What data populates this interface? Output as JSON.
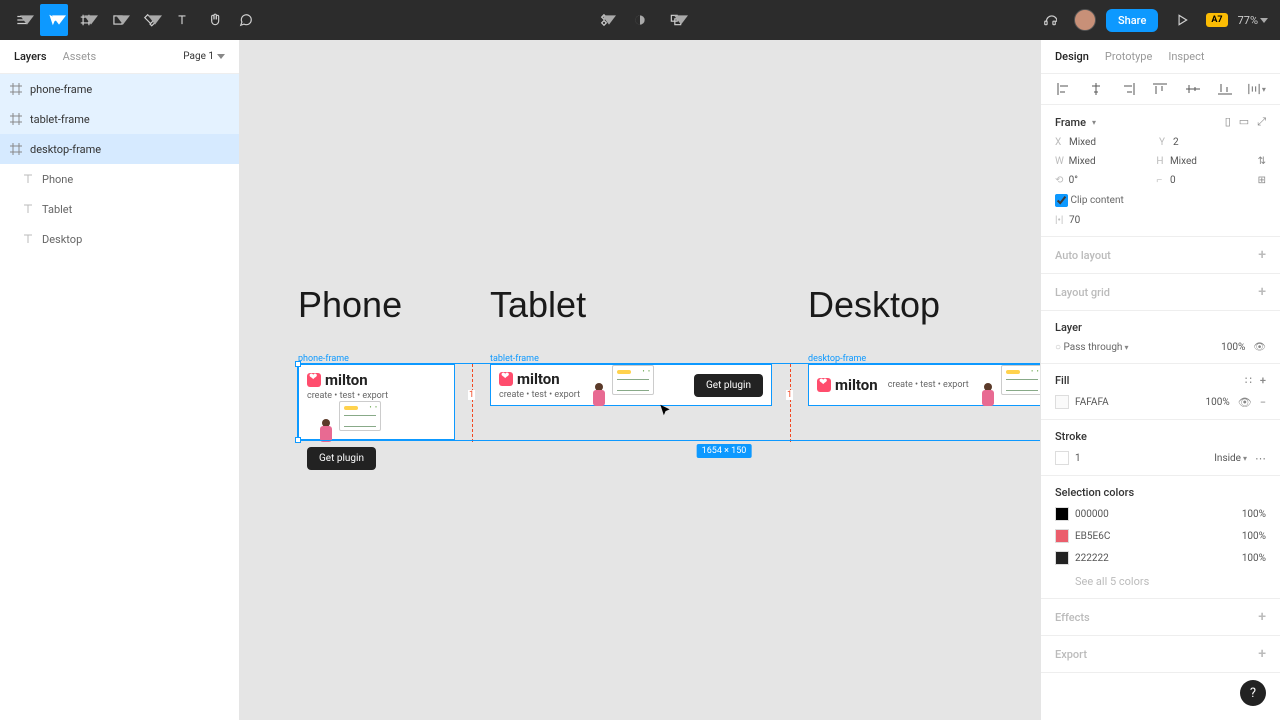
{
  "toolbar": {
    "share_label": "Share",
    "badge": "A7",
    "zoom": "77%"
  },
  "left_panel": {
    "tabs": {
      "layers": "Layers",
      "assets": "Assets"
    },
    "page_label": "Page 1",
    "layers": [
      {
        "name": "phone-frame",
        "icon": "frame",
        "selected": true
      },
      {
        "name": "tablet-frame",
        "icon": "frame",
        "selected": true
      },
      {
        "name": "desktop-frame",
        "icon": "frame",
        "selected": true
      },
      {
        "name": "Phone",
        "icon": "text",
        "selected": false
      },
      {
        "name": "Tablet",
        "icon": "text",
        "selected": false
      },
      {
        "name": "Desktop",
        "icon": "text",
        "selected": false
      }
    ]
  },
  "canvas": {
    "titles": {
      "phone": "Phone",
      "tablet": "Tablet",
      "desktop": "Desktop"
    },
    "frame_tags": {
      "phone": "phone-frame",
      "tablet": "tablet-frame",
      "desktop": "desktop-frame"
    },
    "card": {
      "brand": "milton",
      "tagline": "create • test • export",
      "button": "Get plugin"
    },
    "selection_dims": "1654 × 150",
    "guide_left": "1",
    "guide_right": "1"
  },
  "right_panel": {
    "tabs": {
      "design": "Design",
      "prototype": "Prototype",
      "inspect": "Inspect"
    },
    "frame_label": "Frame",
    "x": {
      "k": "X",
      "v": "Mixed"
    },
    "y": {
      "k": "Y",
      "v": "2"
    },
    "w": {
      "k": "W",
      "v": "Mixed"
    },
    "h": {
      "k": "H",
      "v": "Mixed"
    },
    "rot": {
      "k": "⟲",
      "v": "0°"
    },
    "corner": {
      "k": "⌐",
      "v": "0"
    },
    "clip_label": "Clip content",
    "ib": {
      "k": "|•|",
      "v": "70"
    },
    "auto_layout": "Auto layout",
    "layout_grid": "Layout grid",
    "layer_section": "Layer",
    "pass_through": "Pass through",
    "pass_pct": "100%",
    "fill_section": "Fill",
    "fill_hex": "FAFAFA",
    "fill_pct": "100%",
    "stroke_section": "Stroke",
    "stroke_w": "1",
    "stroke_pos": "Inside",
    "sel_colors_label": "Selection colors",
    "sel_colors": [
      {
        "hex": "000000",
        "pct": "100%",
        "sw": "#000000"
      },
      {
        "hex": "EB5E6C",
        "pct": "100%",
        "sw": "#EB5E6C"
      },
      {
        "hex": "222222",
        "pct": "100%",
        "sw": "#222222"
      }
    ],
    "see_all": "See all 5 colors",
    "effects": "Effects",
    "export": "Export"
  }
}
